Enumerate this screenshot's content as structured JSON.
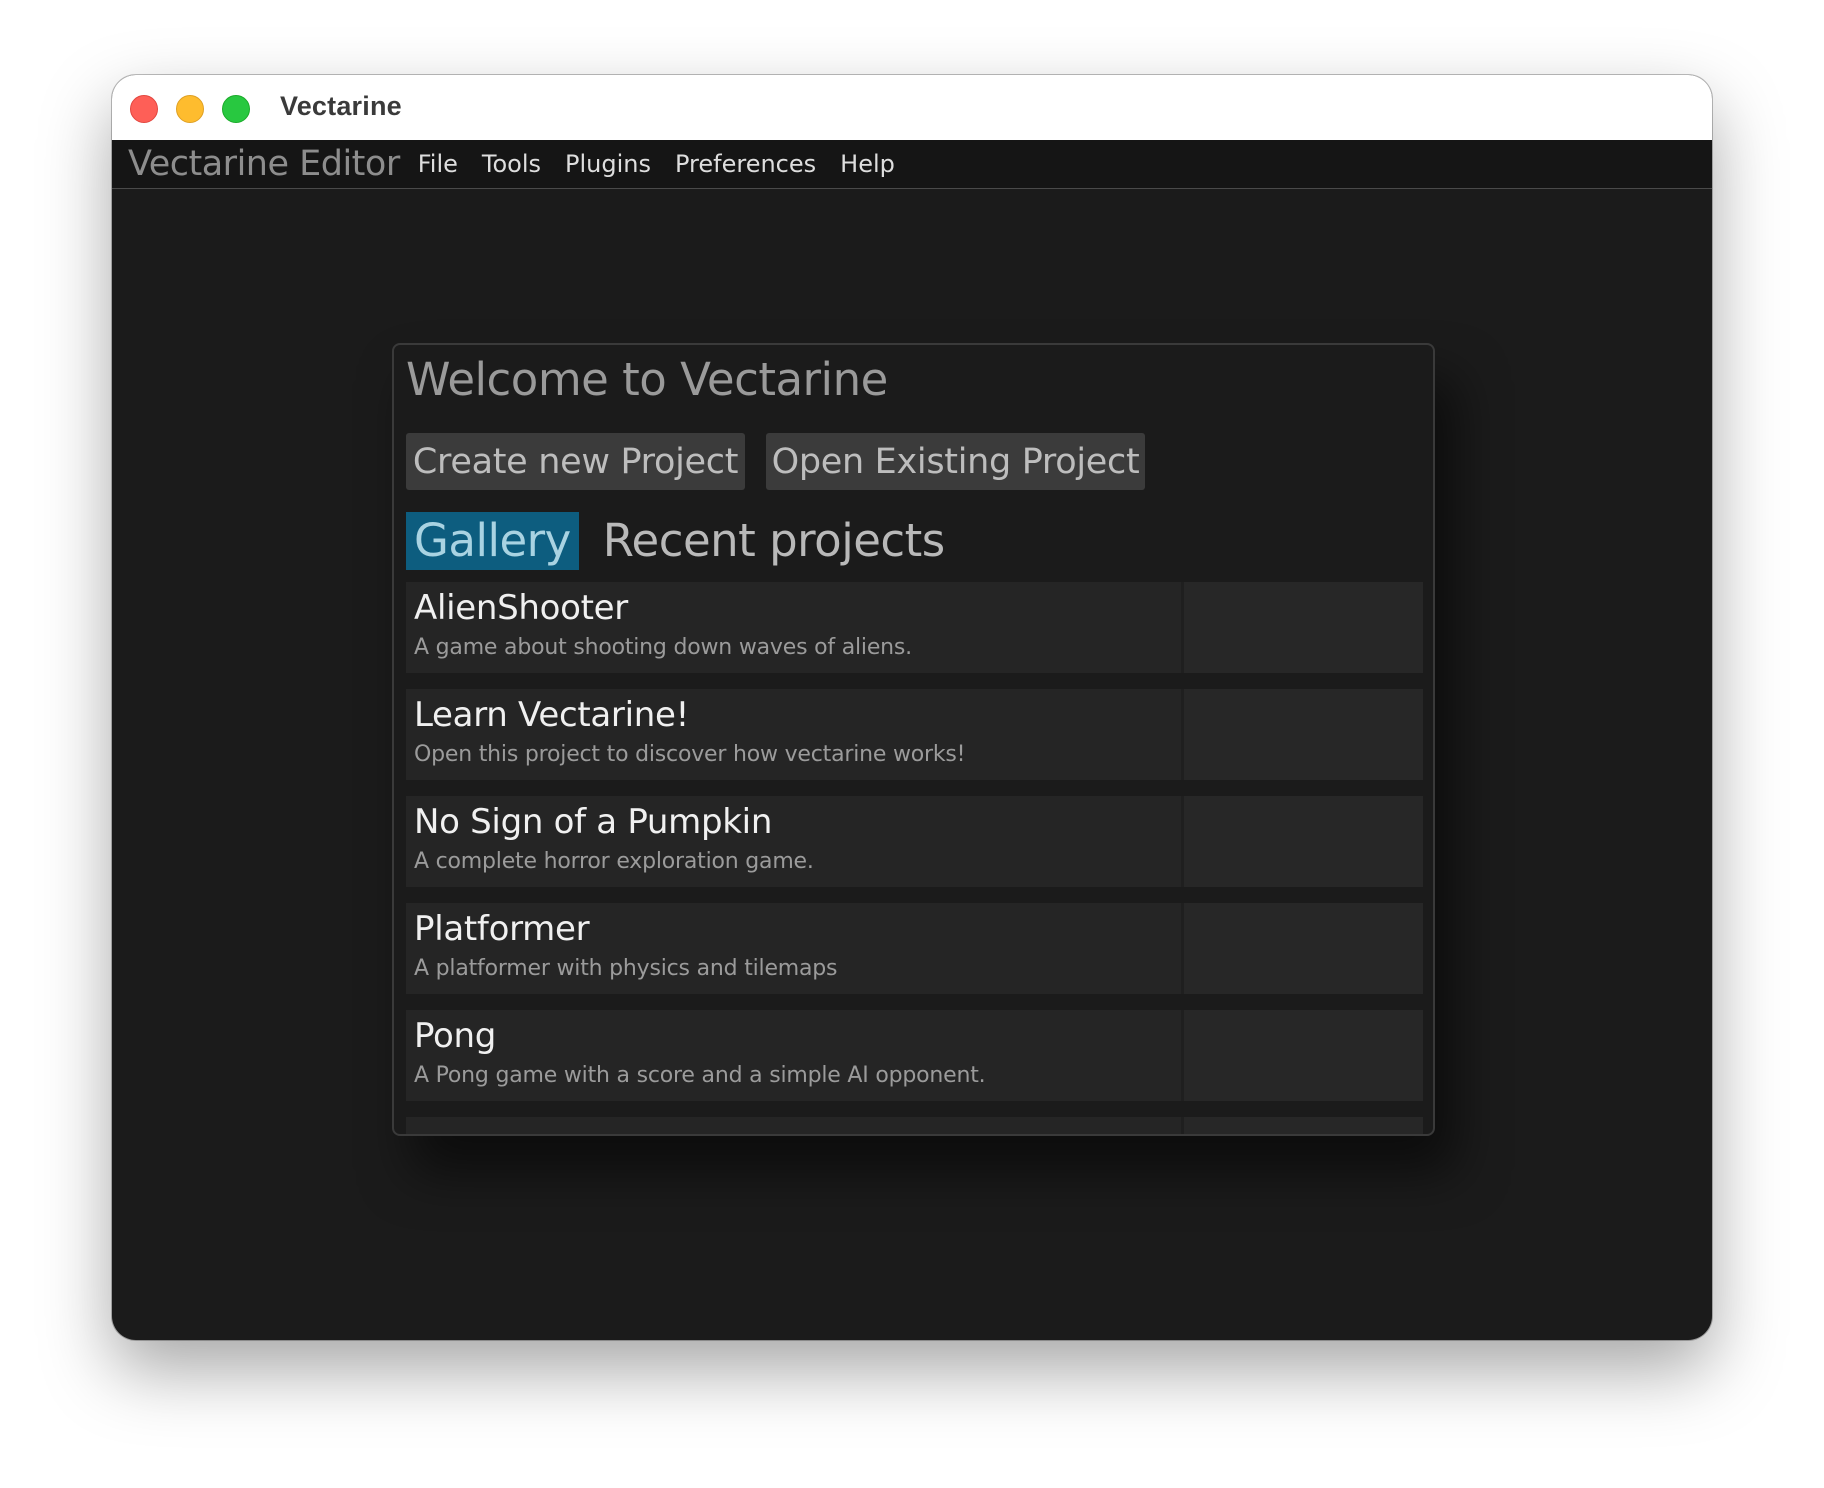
{
  "window": {
    "title": "Vectarine"
  },
  "menubar": {
    "app_name": "Vectarine Editor",
    "items": [
      "File",
      "Tools",
      "Plugins",
      "Preferences",
      "Help"
    ]
  },
  "welcome": {
    "title": "Welcome to Vectarine",
    "create_button": "Create new Project",
    "open_button": "Open Existing Project",
    "tabs": [
      {
        "label": "Gallery",
        "active": true
      },
      {
        "label": "Recent projects",
        "active": false
      }
    ],
    "projects": [
      {
        "name": "AlienShooter",
        "description": "A game about shooting down waves of aliens."
      },
      {
        "name": "Learn Vectarine!",
        "description": "Open this project to discover how vectarine works!"
      },
      {
        "name": "No Sign of a Pumpkin",
        "description": "A complete horror exploration game."
      },
      {
        "name": "Platformer",
        "description": "A platformer with physics and tilemaps"
      },
      {
        "name": "Pong",
        "description": "A Pong game with a score and a simple AI opponent."
      }
    ]
  },
  "colors": {
    "accent_tab": "#0d5d7f",
    "background": "#1b1b1b",
    "button": "#3b3b3b",
    "traffic_close": "#fe5f57",
    "traffic_minimize": "#febc2e",
    "traffic_maximize": "#28c840"
  }
}
